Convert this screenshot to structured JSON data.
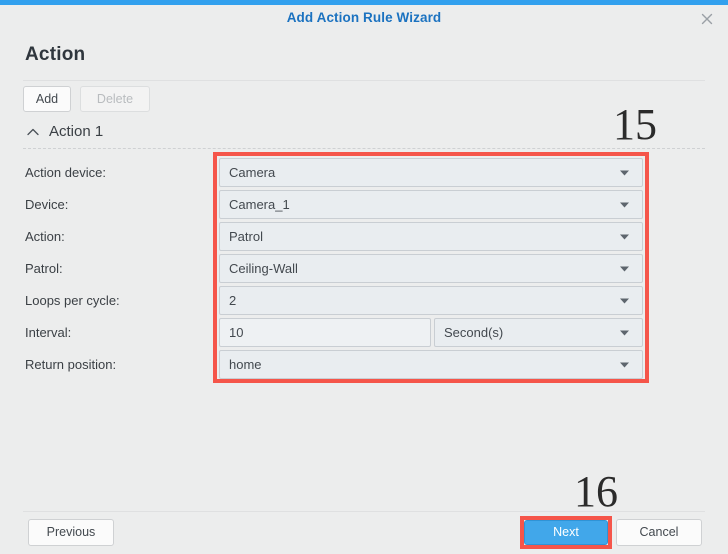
{
  "window": {
    "title": "Add Action Rule Wizard",
    "close_icon": "close-icon",
    "accent_color": "#32a0ee",
    "title_color": "#1b72c0"
  },
  "page": {
    "heading": "Action"
  },
  "toolbar": {
    "add_label": "Add",
    "delete_label": "Delete",
    "delete_disabled": true
  },
  "group": {
    "collapse_icon": "chevron-up-icon",
    "title": "Action 1"
  },
  "form": {
    "rows": [
      {
        "label": "Action device:",
        "value": "Camera",
        "control": "dropdown"
      },
      {
        "label": "Device:",
        "value": "Camera_1",
        "control": "dropdown"
      },
      {
        "label": "Action:",
        "value": "Patrol",
        "control": "dropdown"
      },
      {
        "label": "Patrol:",
        "value": "Ceiling-Wall",
        "control": "dropdown"
      },
      {
        "label": "Loops per cycle:",
        "value": "2",
        "control": "dropdown"
      },
      {
        "label": "Interval:",
        "value": "10",
        "control": "text",
        "unit_value": "Second(s)",
        "unit_control": "dropdown"
      },
      {
        "label": "Return position:",
        "value": "home",
        "control": "dropdown"
      }
    ]
  },
  "footer": {
    "previous_label": "Previous",
    "next_label": "Next",
    "cancel_label": "Cancel"
  },
  "annotations": {
    "fields_step": "15",
    "next_step": "16",
    "highlight_color": "#f5554a"
  }
}
